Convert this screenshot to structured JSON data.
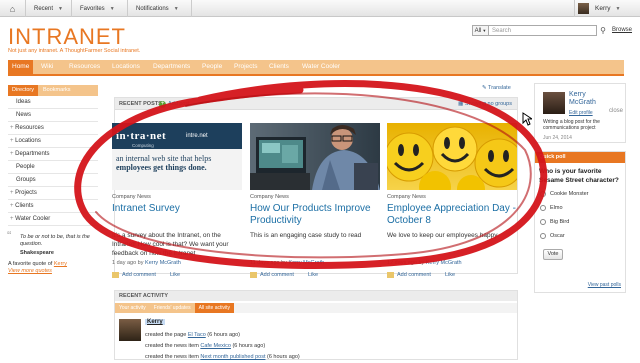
{
  "topbar": {
    "recent": "Recent",
    "favorites": "Favorites",
    "notifications": "Notifications",
    "user": "Kerry"
  },
  "brand": {
    "logo": "INTRANET",
    "tagline": "Not just any intranet. A ThoughtFarmer Social intranet."
  },
  "search": {
    "scope": "All",
    "placeholder": "Search",
    "browse": "Browse"
  },
  "nav": [
    "Home",
    "Wiki",
    "Resources",
    "Locations",
    "Departments",
    "People",
    "Projects",
    "Clients",
    "Water Cooler"
  ],
  "sidebar": {
    "tab_directory": "Directory",
    "tab_favorites": "Bookmarks",
    "items": [
      "Ideas",
      "News",
      "Resources",
      "Locations",
      "Departments",
      "People",
      "Groups",
      "Projects",
      "Clients",
      "Water Cooler"
    ]
  },
  "quote": {
    "text": "To be or not to be, that is the question.",
    "author": "Shakespeare",
    "favorite_prefix": "A favorite quote of",
    "favorite_user": "Kerry",
    "view_more": "View more quotes"
  },
  "translate": "Translate",
  "recent_posts": {
    "heading": "RECENT POSTS",
    "add": "Add post",
    "showing": "Showing no groups",
    "cards": [
      {
        "category": "Company News",
        "title": "Intranet Survey",
        "excerpt": "It's a survey about the Intranet, on the Intranet! How cool is that? We want your feedback on how the intranet",
        "date": "1 day ago by",
        "author": "Kerry McGrath",
        "comment": "Add comment",
        "like": "Like",
        "image": {
          "brand": "in·tra·net",
          "site": "intre.net",
          "sub": "Computing",
          "line1": "an internal web site that helps",
          "line2": "employees get things done."
        }
      },
      {
        "category": "Company News",
        "title": "How Our Products Improve Productivity",
        "excerpt": "This is an engaging case study to read",
        "date": "11 days ago by",
        "author": "Kerry McGrath",
        "comment": "Add comment",
        "like": "Like"
      },
      {
        "category": "Company News",
        "title": "Employee Appreciation Day - October 8",
        "excerpt": "We love to keep our employees happy.",
        "date": "12 days ago by",
        "author": "Kerry McGrath",
        "comment": "Add comment",
        "like": "Like"
      }
    ]
  },
  "recent_activity": {
    "heading": "RECENT ACTIVITY",
    "tabs": [
      "Your activity",
      "Friends' updates",
      "All site activity"
    ],
    "user": "Kerry",
    "lines": [
      {
        "text": "created the page",
        "link": "El Taco",
        "time": "(6 hours ago)"
      },
      {
        "text": "created the news item",
        "link": "Cafe Mexico",
        "time": "(6 hours ago)"
      },
      {
        "text": "created the news item",
        "link": "Next month published post",
        "time": "(6 hours ago)"
      }
    ]
  },
  "profile": {
    "first": "Kerry",
    "last": "McGrath",
    "edit": "Edit profile",
    "blog": "Writing a blog post for the communications project",
    "date": "Jun 24, 2014",
    "close": "close"
  },
  "poll": {
    "heading": "Quick poll",
    "question": "Who is your favorite Sesame Street character?",
    "options": [
      "Cookie Monster",
      "Elmo",
      "Big Bird",
      "Oscar"
    ],
    "vote": "Vote",
    "view_past": "View past polls"
  }
}
